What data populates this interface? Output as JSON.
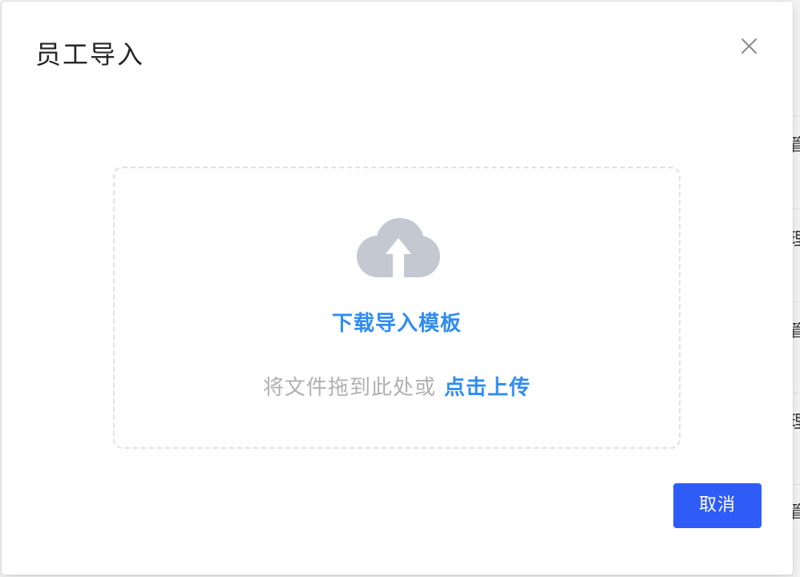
{
  "modal": {
    "title": "员工导入",
    "close_icon": "close-icon"
  },
  "dropzone": {
    "icon": "cloud-upload-icon",
    "download_template_label": "下载导入模板",
    "hint_text": "将文件拖到此处或",
    "upload_link_label": "点击上传"
  },
  "footer": {
    "cancel_label": "取消"
  },
  "background": {
    "fragments": [
      "管",
      "理",
      "管",
      "理",
      "管"
    ]
  },
  "colors": {
    "link": "#2f8cf0",
    "primary_button": "#2f5cf7",
    "icon_gray": "#c4c8d0",
    "hint_gray": "#b0b0b0"
  }
}
